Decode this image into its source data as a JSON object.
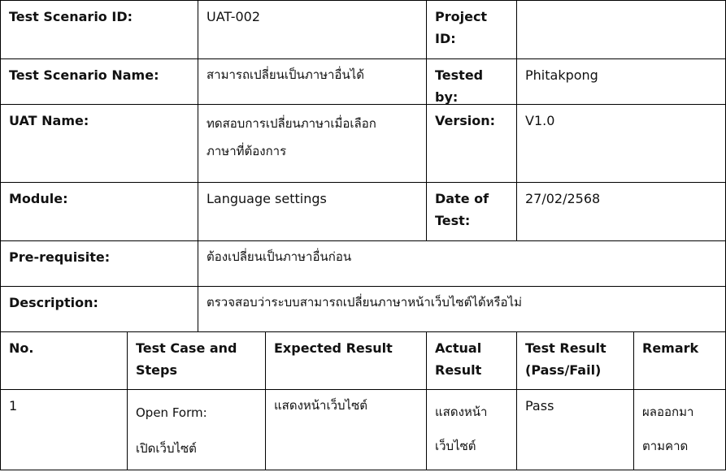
{
  "header_rows": {
    "scenario_id": {
      "label": "Test Scenario ID:",
      "value": "UAT-002",
      "label2": "Project\nID:",
      "value2": ""
    },
    "scenario_name": {
      "label": "Test Scenario Name:",
      "value": "สามารถเปลี่ยนเป็นภาษาอื่นได้",
      "label2": "Tested by:",
      "value2": "Phitakpong"
    },
    "uat_name": {
      "label": "UAT Name:",
      "value": "ทดสอบการเปลี่ยนภาษาเมื่อเลือก\nภาษาที่ต้องการ",
      "label2": "Version:",
      "value2": "V1.0"
    },
    "module": {
      "label": "Module:",
      "value": "Language settings",
      "label2": "Date of\nTest:",
      "value2": "27/02/2568"
    },
    "prerequisite": {
      "label": "Pre-requisite:",
      "value": "ต้องเปลี่ยนเป็นภาษาอื่นก่อน"
    },
    "description": {
      "label": "Description:",
      "value": "ตรวจสอบว่าระบบสามารถเปลี่ยนภาษาหน้าเว็บไซต์ได้หรือไม่"
    }
  },
  "case_table": {
    "columns": [
      "No.",
      "Test Case and\nSteps",
      "Expected Result",
      "Actual\nResult",
      "Test Result\n(Pass/Fail)",
      "Remark"
    ],
    "rows": [
      [
        "1",
        "Open Form:\nเปิดเว็บไซต์",
        "แสดงหน้าเว็บไซต์",
        "แสดงหน้า\nเว็บไซต์",
        "Pass",
        "ผลออกมา\nตามคาด"
      ]
    ]
  }
}
